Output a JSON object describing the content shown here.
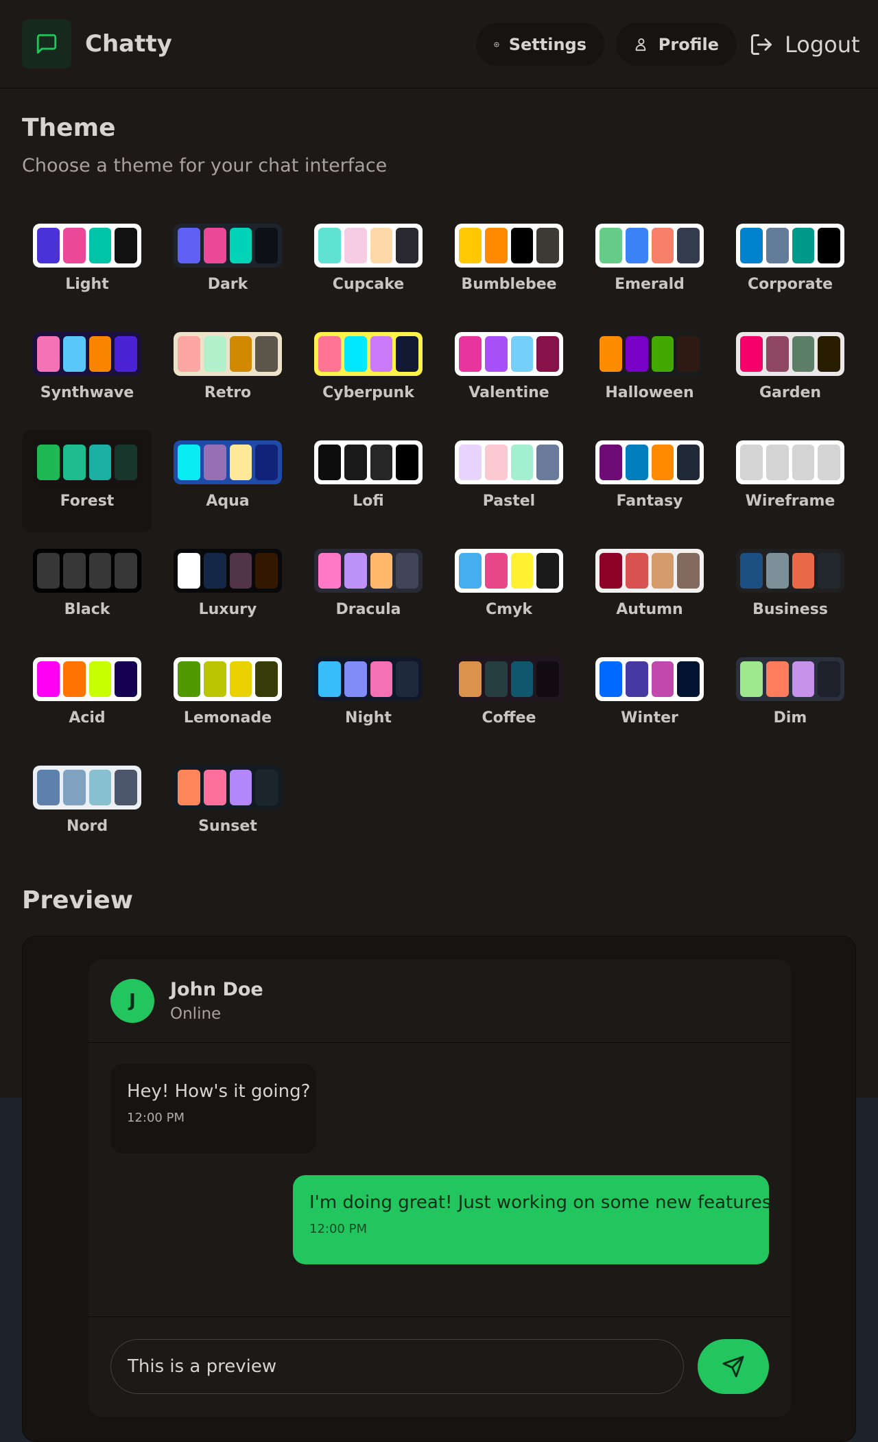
{
  "app": {
    "title": "Chatty"
  },
  "nav": {
    "settings_label": "Settings",
    "profile_label": "Profile",
    "logout_label": "Logout"
  },
  "colors": {
    "accent": "#22c55e",
    "background": "#1c1917",
    "surface": "#161311"
  },
  "theme_section": {
    "heading": "Theme",
    "subheading": "Choose a theme for your chat interface",
    "selected": "Forest",
    "themes": [
      {
        "name": "Light",
        "frame": "#ffffff",
        "colors": [
          "#4b32d8",
          "#ec4899",
          "#00c4a8",
          "#111111"
        ]
      },
      {
        "name": "Dark",
        "frame": "#1d232a",
        "colors": [
          "#6060f5",
          "#ec4899",
          "#00d3b7",
          "#0d1117"
        ]
      },
      {
        "name": "Cupcake",
        "frame": "#ffffff",
        "colors": [
          "#60e2d2",
          "#f6cce4",
          "#fdd9a9",
          "#2a292f"
        ]
      },
      {
        "name": "Bumblebee",
        "frame": "#ffffff",
        "colors": [
          "#ffc800",
          "#ff8a00",
          "#000000",
          "#3d3a36"
        ]
      },
      {
        "name": "Emerald",
        "frame": "#ffffff",
        "colors": [
          "#66cc8a",
          "#3b82f6",
          "#f87f6a",
          "#333c4d"
        ]
      },
      {
        "name": "Corporate",
        "frame": "#ffffff",
        "colors": [
          "#0082ce",
          "#627c9a",
          "#00998a",
          "#000000"
        ]
      },
      {
        "name": "Synthwave",
        "frame": "#1a103d",
        "colors": [
          "#f472b6",
          "#59c7f8",
          "#f98500",
          "#4c22d6"
        ]
      },
      {
        "name": "Retro",
        "frame": "#ece3ca",
        "colors": [
          "#fda7a4",
          "#b2f1cc",
          "#d18a00",
          "#5c564a"
        ]
      },
      {
        "name": "Cyberpunk",
        "frame": "#fff248",
        "colors": [
          "#fe7494",
          "#00e8ff",
          "#cb7bfa",
          "#121a33"
        ]
      },
      {
        "name": "Valentine",
        "frame": "#ffffff",
        "colors": [
          "#e8349d",
          "#a850f7",
          "#74d0f8",
          "#87124a"
        ]
      },
      {
        "name": "Halloween",
        "frame": "#1b1b1b",
        "colors": [
          "#ff8c00",
          "#7900c7",
          "#43a900",
          "#2e1a12"
        ]
      },
      {
        "name": "Garden",
        "frame": "#e9e7e7",
        "colors": [
          "#f5006a",
          "#8f4763",
          "#5d7f67",
          "#291d00"
        ]
      },
      {
        "name": "Forest",
        "frame": "#171212",
        "colors": [
          "#1eb854",
          "#1ebd8f",
          "#1bb0a3",
          "#19362d"
        ]
      },
      {
        "name": "Aqua",
        "frame": "#1e4ba8",
        "colors": [
          "#09ecf4",
          "#966fb4",
          "#ffe999",
          "#102378"
        ]
      },
      {
        "name": "Lofi",
        "frame": "#ffffff",
        "colors": [
          "#0d0d0d",
          "#1a1919",
          "#262626",
          "#000000"
        ]
      },
      {
        "name": "Pastel",
        "frame": "#ffffff",
        "colors": [
          "#e8d4fc",
          "#fbc9d1",
          "#a3f0d0",
          "#6a7a9b"
        ]
      },
      {
        "name": "Fantasy",
        "frame": "#ffffff",
        "colors": [
          "#6e0b75",
          "#007ebd",
          "#ff8a00",
          "#1f2937"
        ]
      },
      {
        "name": "Wireframe",
        "frame": "#ffffff",
        "colors": [
          "#d4d4d4",
          "#d4d4d4",
          "#d4d4d4",
          "#d4d4d4"
        ]
      },
      {
        "name": "Black",
        "frame": "#000000",
        "colors": [
          "#373737",
          "#373737",
          "#373737",
          "#373737"
        ]
      },
      {
        "name": "Luxury",
        "frame": "#09090b",
        "colors": [
          "#ffffff",
          "#152747",
          "#513448",
          "#331800"
        ]
      },
      {
        "name": "Dracula",
        "frame": "#282a36",
        "colors": [
          "#ff79c6",
          "#bd93f9",
          "#ffb86c",
          "#414558"
        ]
      },
      {
        "name": "Cmyk",
        "frame": "#ffffff",
        "colors": [
          "#45aeee",
          "#e8488a",
          "#fff232",
          "#1a1a1a"
        ]
      },
      {
        "name": "Autumn",
        "frame": "#f1f1f1",
        "colors": [
          "#8c0327",
          "#d85251",
          "#d59b6a",
          "#826a5c"
        ]
      },
      {
        "name": "Business",
        "frame": "#202020",
        "colors": [
          "#1c4f82",
          "#7c909a",
          "#ea6947",
          "#23282e"
        ]
      },
      {
        "name": "Acid",
        "frame": "#fafafa",
        "colors": [
          "#ff00f4",
          "#ff7400",
          "#c8ff00",
          "#140152"
        ]
      },
      {
        "name": "Lemonade",
        "frame": "#ffffff",
        "colors": [
          "#519903",
          "#bcc502",
          "#e9d200",
          "#373c08"
        ]
      },
      {
        "name": "Night",
        "frame": "#0f1729",
        "colors": [
          "#38bdf8",
          "#818cf8",
          "#f471b5",
          "#1e293b"
        ]
      },
      {
        "name": "Coffee",
        "frame": "#20161f",
        "colors": [
          "#db924b",
          "#263e3f",
          "#10576d",
          "#120c12"
        ]
      },
      {
        "name": "Winter",
        "frame": "#ffffff",
        "colors": [
          "#0069ff",
          "#463aa2",
          "#c148ac",
          "#021431"
        ]
      },
      {
        "name": "Dim",
        "frame": "#2a303c",
        "colors": [
          "#9fe88d",
          "#ff7d5c",
          "#c792e9",
          "#1c212b"
        ]
      },
      {
        "name": "Nord",
        "frame": "#eceff4",
        "colors": [
          "#5e81ac",
          "#81a1c1",
          "#88c0d0",
          "#4c566a"
        ]
      },
      {
        "name": "Sunset",
        "frame": "#121c22",
        "colors": [
          "#ff865b",
          "#fd6f9c",
          "#b387fa",
          "#1b262c"
        ]
      }
    ]
  },
  "preview_section": {
    "heading": "Preview",
    "contact": {
      "initial": "J",
      "name": "John Doe",
      "status": "Online"
    },
    "messages": [
      {
        "text": "Hey! How's it going?",
        "time": "12:00 PM",
        "sent": false
      },
      {
        "text": "I'm doing great! Just working on some new features.",
        "time": "12:00 PM",
        "sent": true
      }
    ],
    "input_value": "This is a preview"
  }
}
